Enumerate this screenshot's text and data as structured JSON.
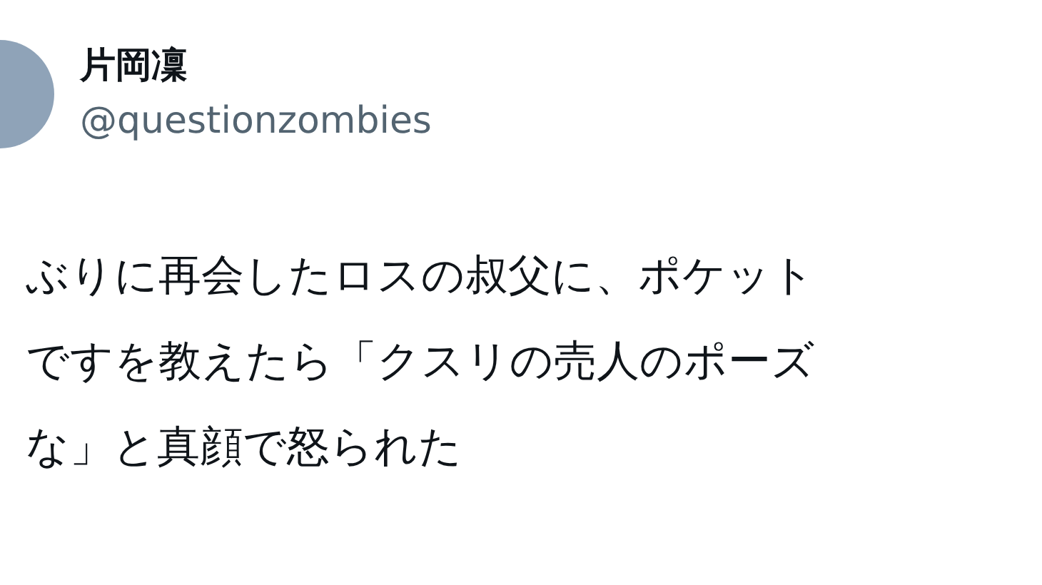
{
  "author": {
    "name": "片岡凜",
    "handle": "@questionzombies"
  },
  "post": {
    "lines": [
      "ぶりに再会したロスの叔父に、ポケット",
      "ですを教えたら「クスリの売人のポーズ",
      "な」と真顔で怒られた"
    ]
  }
}
